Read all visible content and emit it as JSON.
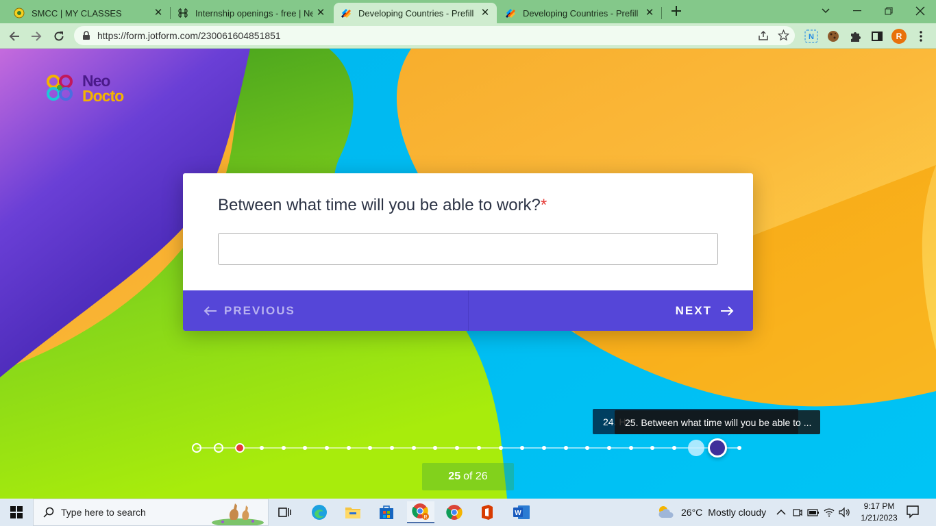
{
  "browser": {
    "tabs": [
      {
        "title": "SMCC | MY CLASSES",
        "icon": "smcc-favicon-icon",
        "active": false
      },
      {
        "title": "Internship openings - free | Neo",
        "icon": "command-favicon-icon",
        "active": false
      },
      {
        "title": "Developing Countries - Prefill fro",
        "icon": "jotform-favicon-icon",
        "active": true
      },
      {
        "title": "Developing Countries - Prefill fro",
        "icon": "jotform-favicon-icon",
        "active": false
      }
    ],
    "url": "https://form.jotform.com/230061604851851",
    "profile_initial": "R",
    "colors": {
      "frame": "#84c88a",
      "toolbar": "#cfeccf"
    }
  },
  "page": {
    "logo": {
      "line1": "Neo",
      "line2": "Docto"
    },
    "question": {
      "text": "Between what time will you be able to work?",
      "required_mark": "*"
    },
    "answer": {
      "value": "",
      "placeholder": ""
    },
    "buttons": {
      "previous": "PREVIOUS",
      "next": "NEXT"
    },
    "tooltip_back": "24. H",
    "tooltip": "25. Between what time will you be able to ...",
    "progress": {
      "current": "25",
      "of_label": "of 26",
      "total_steps": 26
    },
    "colors": {
      "nav": "#5546d8",
      "required": "#e53935",
      "current_dot": "#3f2f9a",
      "error_dot": "#e53935"
    }
  },
  "taskbar": {
    "search_placeholder": "Type here to search",
    "weather": {
      "temp": "26°C",
      "desc": "Mostly cloudy"
    },
    "time": "9:17 PM",
    "date": "1/21/2023"
  }
}
